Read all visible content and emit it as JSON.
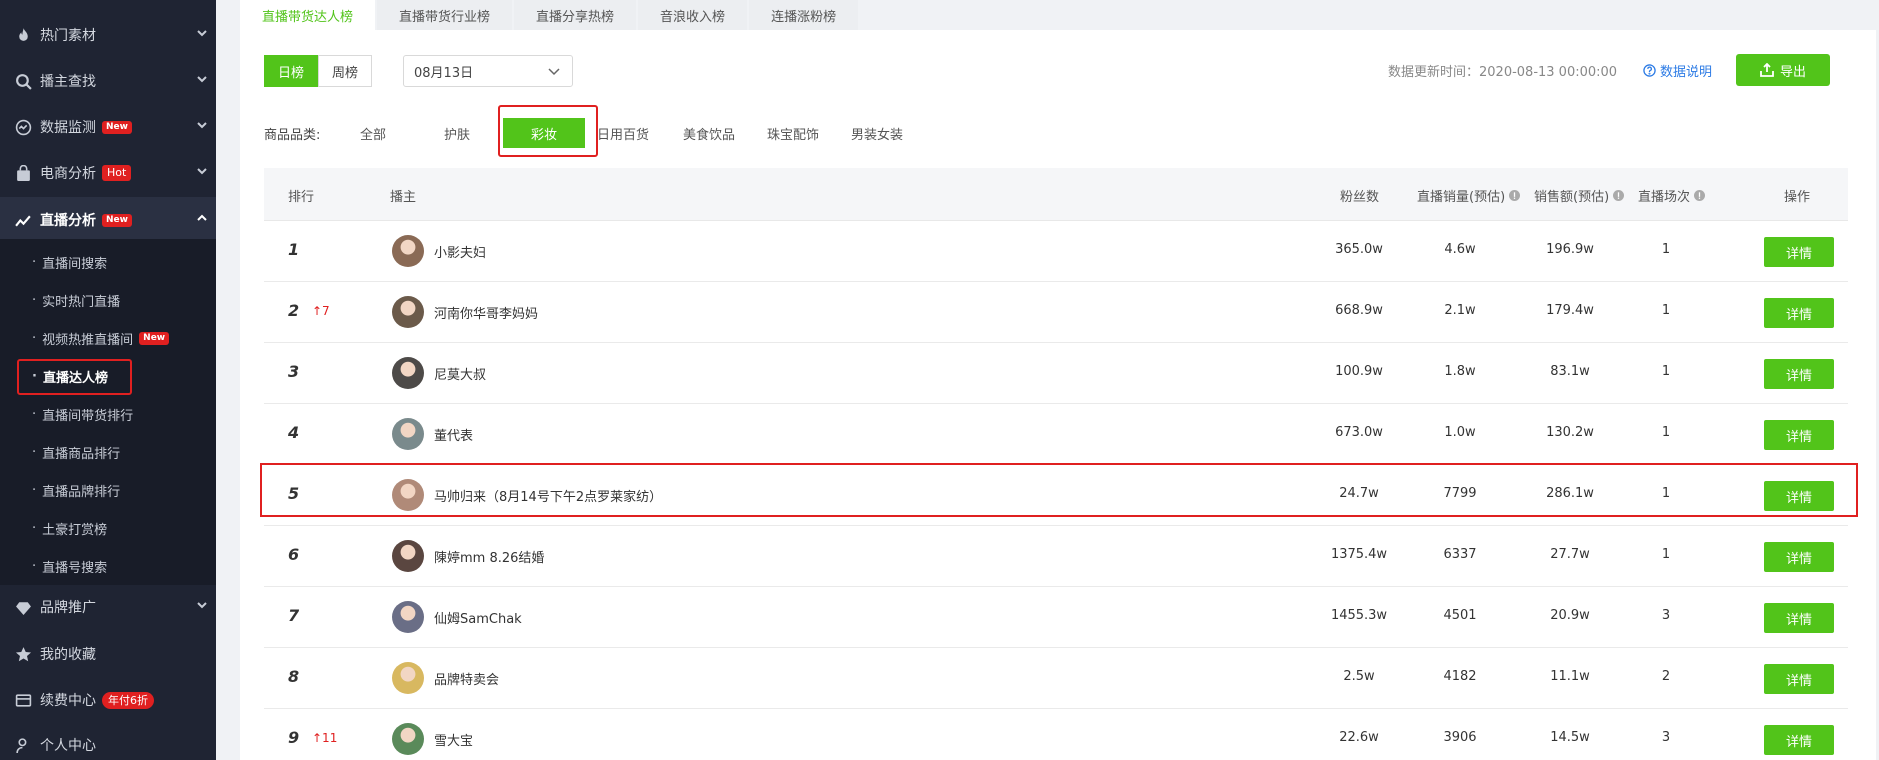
{
  "sidebar": {
    "items": [
      {
        "label": "热门素材",
        "icon": "flame-icon"
      },
      {
        "label": "播主查找",
        "icon": "search-icon"
      },
      {
        "label": "数据监测",
        "icon": "monitor-icon",
        "badge": "New"
      },
      {
        "label": "电商分析",
        "icon": "shopping-bag-icon",
        "badge": "Hot"
      },
      {
        "label": "直播分析",
        "icon": "trend-line-icon",
        "badge": "New"
      }
    ],
    "sub_items": [
      {
        "label": "直播间搜索"
      },
      {
        "label": "实时热门直播"
      },
      {
        "label": "视频热推直播间",
        "badge": "New"
      },
      {
        "label": "直播达人榜"
      },
      {
        "label": "直播间带货排行"
      },
      {
        "label": "直播商品排行"
      },
      {
        "label": "直播品牌排行"
      },
      {
        "label": "土豪打赏榜"
      },
      {
        "label": "直播号搜索"
      }
    ],
    "bottom_items": [
      {
        "label": "品牌推广",
        "icon": "diamond-icon"
      },
      {
        "label": "我的收藏",
        "icon": "star-icon"
      },
      {
        "label": "续费中心",
        "icon": "card-icon",
        "badge": "年付6折"
      },
      {
        "label": "个人中心",
        "icon": "user-icon"
      }
    ]
  },
  "tabs": [
    "直播带货达人榜",
    "直播带货行业榜",
    "直播分享热榜",
    "音浪收入榜",
    "连播涨粉榜"
  ],
  "toolbar": {
    "day": "日榜",
    "week": "周榜",
    "date": "08月13日",
    "update_label": "数据更新时间：2020-08-13 00:00:00",
    "explain": "数据说明",
    "export": "导出"
  },
  "categories": {
    "label": "商品品类:",
    "items": [
      "全部",
      "护肤",
      "彩妆",
      "日用百货",
      "美食饮品",
      "珠宝配饰",
      "男装女装"
    ]
  },
  "table": {
    "headers": {
      "rank": "排行",
      "host": "播主",
      "fans": "粉丝数",
      "sales": "直播销量(预估)",
      "amount": "销售额(预估)",
      "sessions": "直播场次",
      "action": "操作"
    },
    "detail_label": "详情",
    "rows": [
      {
        "rank": "1",
        "trend": "",
        "name": "小影夫妇",
        "fans": "365.0w",
        "sales": "4.6w",
        "amount": "196.9w",
        "sessions": "1",
        "avatar_color": "#8a6a55"
      },
      {
        "rank": "2",
        "trend": "↑7",
        "name": "河南你华哥李妈妈",
        "fans": "668.9w",
        "sales": "2.1w",
        "amount": "179.4w",
        "sessions": "1",
        "avatar_color": "#6b5a4a"
      },
      {
        "rank": "3",
        "trend": "",
        "name": "尼莫大叔",
        "fans": "100.9w",
        "sales": "1.8w",
        "amount": "83.1w",
        "sessions": "1",
        "avatar_color": "#4d4a48"
      },
      {
        "rank": "4",
        "trend": "",
        "name": "董代表",
        "fans": "673.0w",
        "sales": "1.0w",
        "amount": "130.2w",
        "sessions": "1",
        "avatar_color": "#7a8a8c"
      },
      {
        "rank": "5",
        "trend": "",
        "name": "马帅归来（8月14号下午2点罗莱家纺）",
        "fans": "24.7w",
        "sales": "7799",
        "amount": "286.1w",
        "sessions": "1",
        "avatar_color": "#b08a78"
      },
      {
        "rank": "6",
        "trend": "",
        "name": "陳婷mm 8.26结婚",
        "fans": "1375.4w",
        "sales": "6337",
        "amount": "27.7w",
        "sessions": "1",
        "avatar_color": "#5a4640"
      },
      {
        "rank": "7",
        "trend": "",
        "name": "仙姆SamChak",
        "fans": "1455.3w",
        "sales": "4501",
        "amount": "20.9w",
        "sessions": "3",
        "avatar_color": "#6a6e86"
      },
      {
        "rank": "8",
        "trend": "",
        "name": "品牌特卖会",
        "fans": "2.5w",
        "sales": "4182",
        "amount": "11.1w",
        "sessions": "2",
        "avatar_color": "#d8b860"
      },
      {
        "rank": "9",
        "trend": "↑11",
        "name": "雪大宝",
        "fans": "22.6w",
        "sales": "3906",
        "amount": "14.5w",
        "sessions": "3",
        "avatar_color": "#5a8a5a"
      }
    ]
  },
  "colors": {
    "accent": "#52c41a",
    "highlight": "#e02020",
    "sidebar": "#1f2433"
  }
}
